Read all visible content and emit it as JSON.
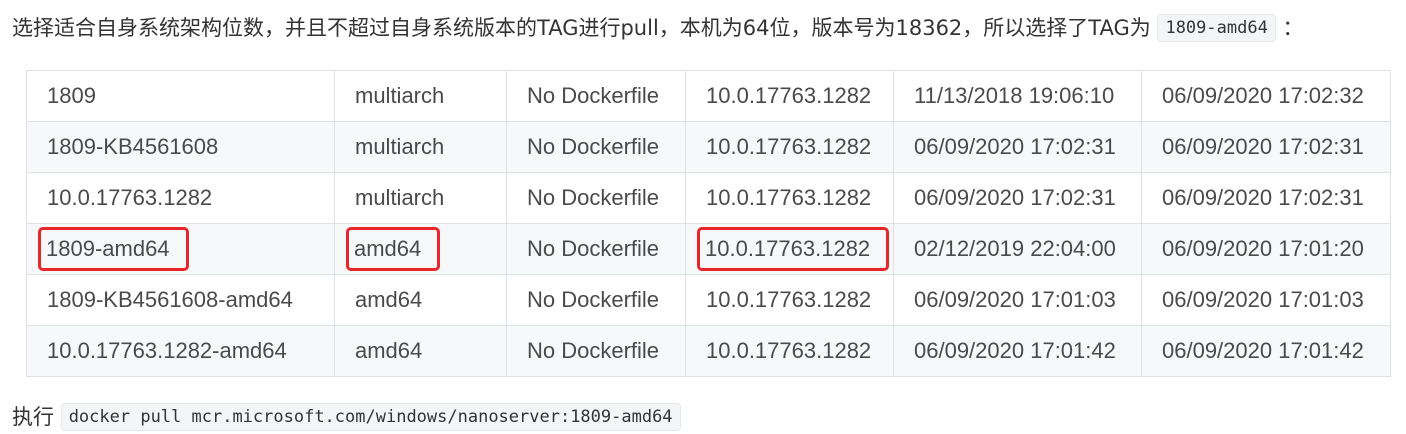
{
  "intro": {
    "text": "选择适合自身系统架构位数，并且不超过自身系统版本的TAG进行pull，本机为64位，版本号为18362，所以选择了TAG为",
    "code": "1809-amd64",
    "suffix": "："
  },
  "table": {
    "rows": [
      [
        "1809",
        "multiarch",
        "No Dockerfile",
        "10.0.17763.1282",
        "11/13/2018 19:06:10",
        "06/09/2020 17:02:32"
      ],
      [
        "1809-KB4561608",
        "multiarch",
        "No Dockerfile",
        "10.0.17763.1282",
        "06/09/2020 17:02:31",
        "06/09/2020 17:02:31"
      ],
      [
        "10.0.17763.1282",
        "multiarch",
        "No Dockerfile",
        "10.0.17763.1282",
        "06/09/2020 17:02:31",
        "06/09/2020 17:02:31"
      ],
      [
        "1809-amd64",
        "amd64",
        "No Dockerfile",
        "10.0.17763.1282",
        "02/12/2019 22:04:00",
        "06/09/2020 17:01:20"
      ],
      [
        "1809-KB4561608-amd64",
        "amd64",
        "No Dockerfile",
        "10.0.17763.1282",
        "06/09/2020 17:01:03",
        "06/09/2020 17:01:03"
      ],
      [
        "10.0.17763.1282-amd64",
        "amd64",
        "No Dockerfile",
        "10.0.17763.1282",
        "06/09/2020 17:01:42",
        "06/09/2020 17:01:42"
      ]
    ]
  },
  "run": {
    "label": "执行",
    "command": "docker pull mcr.microsoft.com/windows/nanoserver:1809-amd64"
  },
  "colors": {
    "highlight_border": "#e8262b",
    "table_border": "#dfe2e5",
    "stripe_background": "#f6f8fa",
    "code_background": "#f4f5f6"
  }
}
